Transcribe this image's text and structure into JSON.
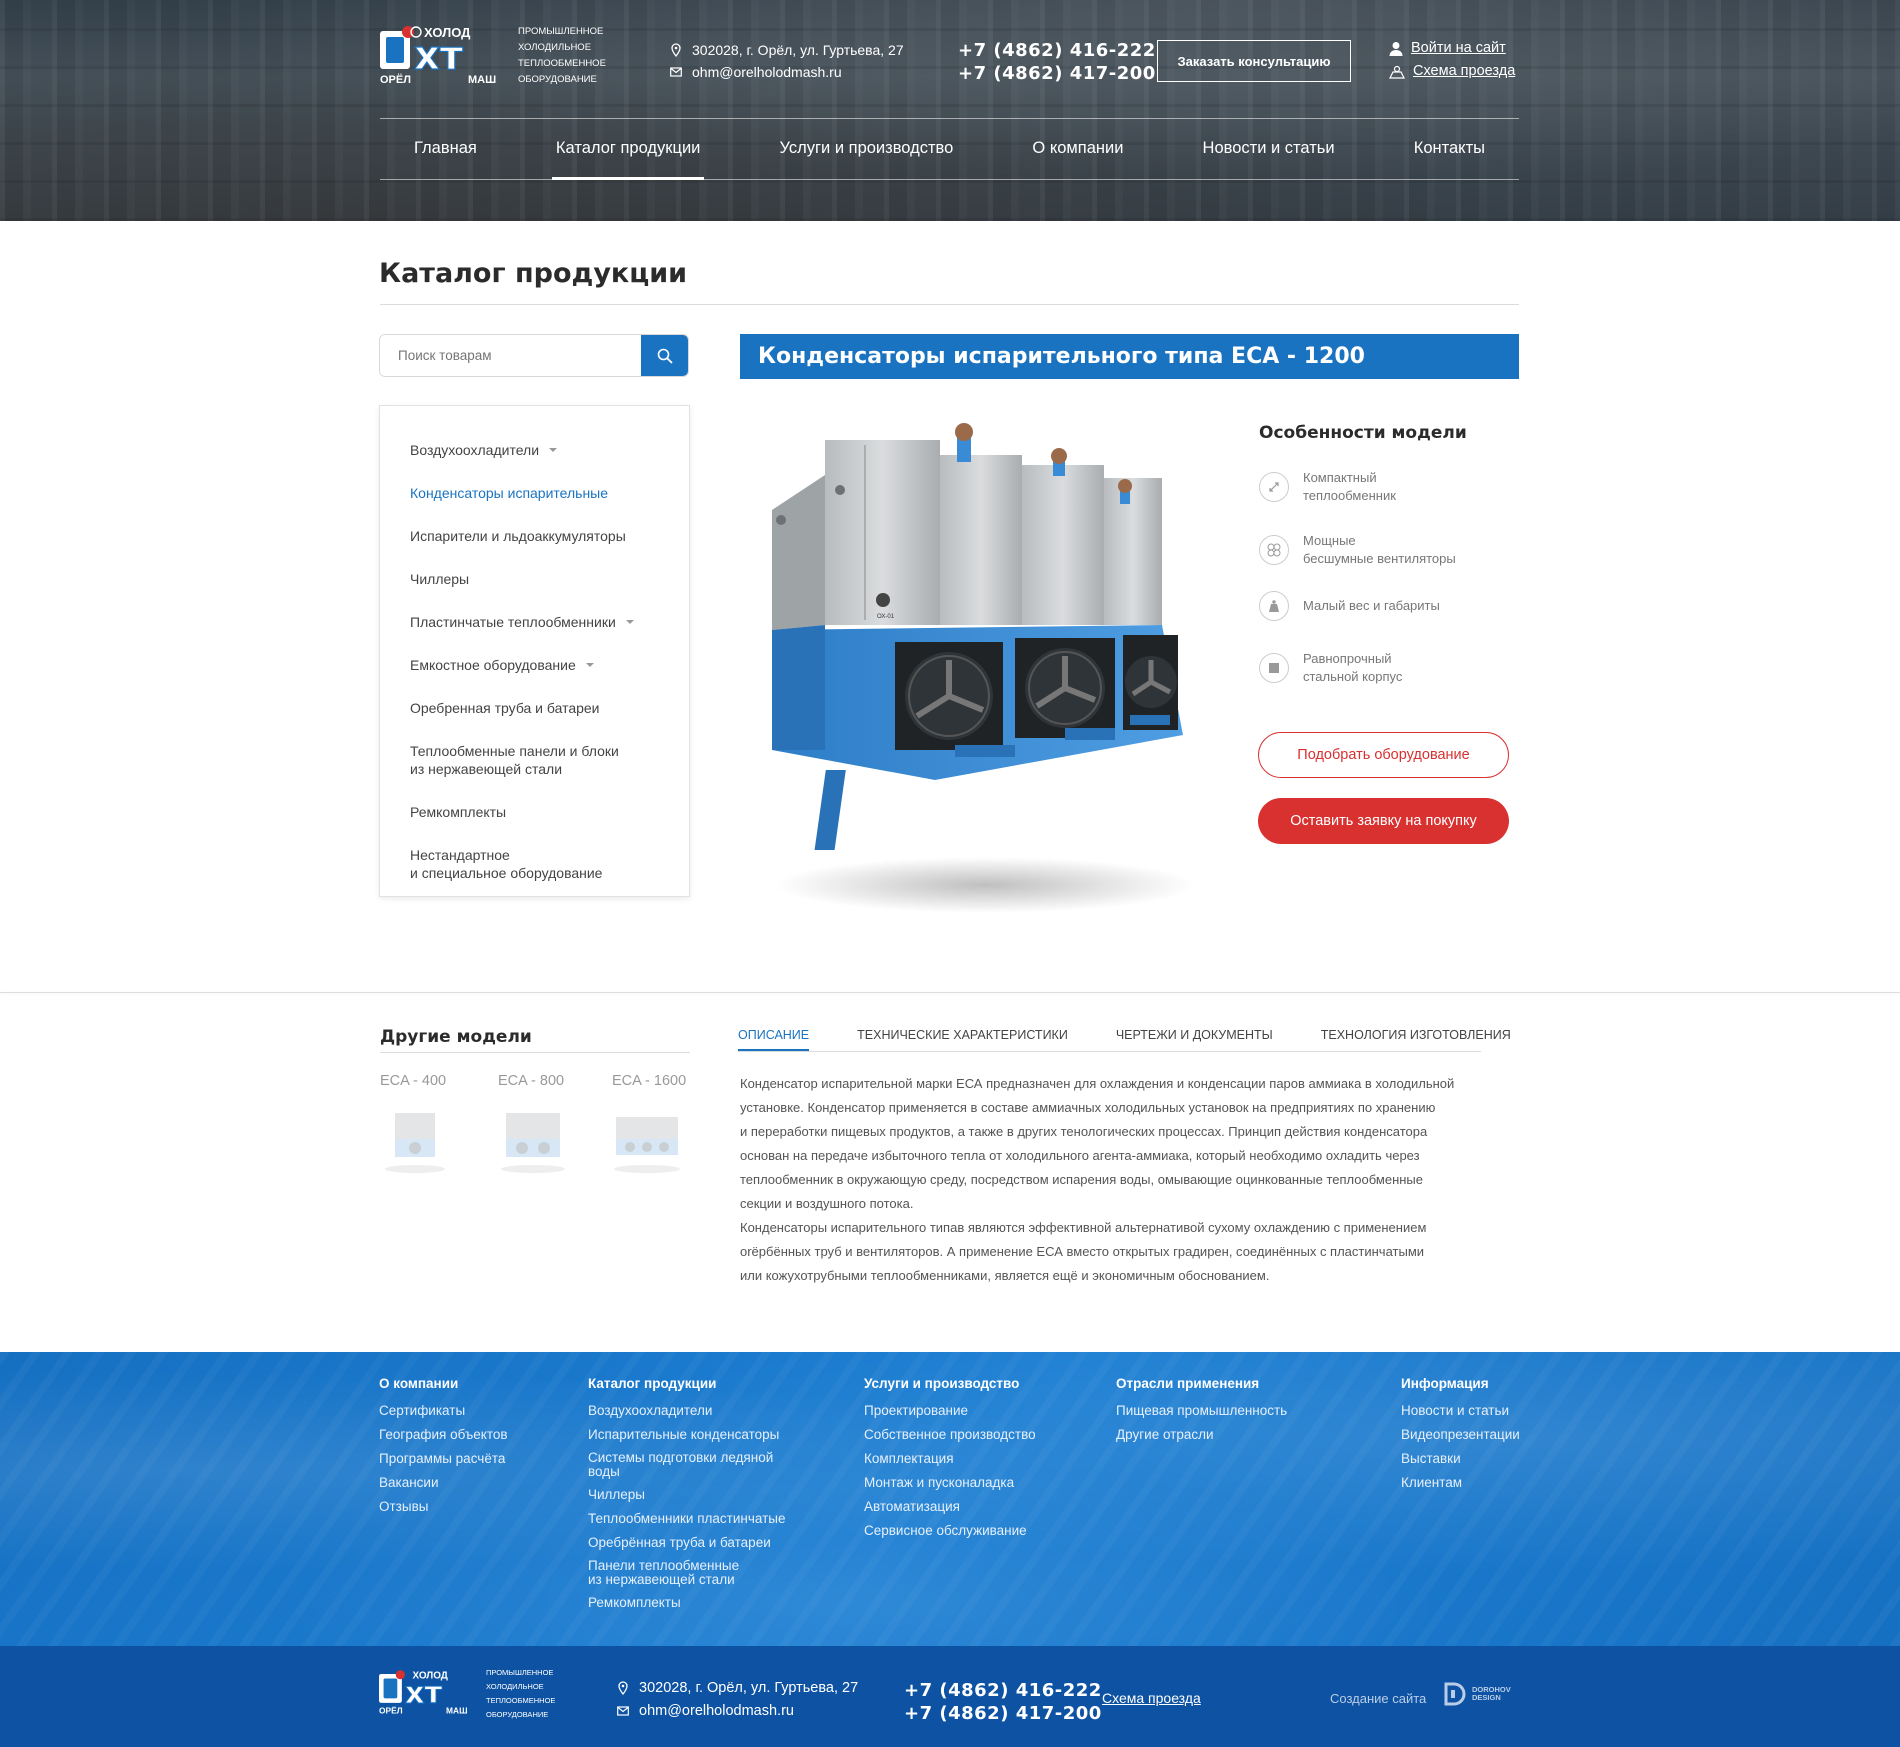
{
  "header": {
    "logo_text": {
      "top": "ХОЛОД",
      "left": "ОРЁЛ",
      "right": "МАШ"
    },
    "logo_subtitle": "ПРОМЫШЛЕННОЕ\nХОЛОДИЛЬНОЕ\nТЕПЛООБМЕННОЕ\nОБОРУДОВАНИЕ",
    "address": "302028, г. Орёл, ул. Гуртьева, 27",
    "email": "ohm@orelholodmash.ru",
    "phone1": "+7 (4862) 416-222",
    "phone2": "+7 (4862) 417-200",
    "consult_button": "Заказать консультацию",
    "login_link": "Войти на сайт",
    "map_link": "Схема проезда"
  },
  "nav": [
    {
      "label": "Главная",
      "active": false
    },
    {
      "label": "Каталог продукции",
      "active": true
    },
    {
      "label": "Услуги и производство",
      "active": false
    },
    {
      "label": "О компании",
      "active": false
    },
    {
      "label": "Новости и статьи",
      "active": false
    },
    {
      "label": "Контакты",
      "active": false
    }
  ],
  "page_title": "Каталог продукции",
  "search": {
    "placeholder": "Поиск товарам"
  },
  "categories": [
    {
      "label": "Воздухоохладители",
      "caret": true,
      "active": false
    },
    {
      "label": "Конденсаторы испарительные",
      "caret": false,
      "active": true
    },
    {
      "label": "Испарители и льдоаккумуляторы",
      "caret": false,
      "active": false
    },
    {
      "label": "Чиллеры",
      "caret": false,
      "active": false
    },
    {
      "label": "Пластинчатые теплообменники",
      "caret": true,
      "active": false
    },
    {
      "label": "Емкостное оборудование",
      "caret": true,
      "active": false
    },
    {
      "label": "Оребренная труба и батареи",
      "caret": false,
      "active": false
    },
    {
      "label": "Теплообменные панели и блоки\nиз нержавеющей стали",
      "caret": false,
      "active": false
    },
    {
      "label": "Ремкомплекты",
      "caret": false,
      "active": false
    },
    {
      "label": "Нестандартное\nи специальное оборудование",
      "caret": false,
      "active": false
    }
  ],
  "product": {
    "title": "Конденсаторы испарительного типа ECA - 1200",
    "image_label": "ОХ-01",
    "features_title": "Особенности модели",
    "features": [
      {
        "icon": "compact-icon",
        "text": "Компактный\nтеплообменник"
      },
      {
        "icon": "fan-icon",
        "text": "Мощные\nбесшумные вентиляторы"
      },
      {
        "icon": "weight-icon",
        "text": "Малый вес и габариты"
      },
      {
        "icon": "body-icon",
        "text": "Равнопрочный\nстальной корпус"
      }
    ],
    "select_button": "Подобрать оборудование",
    "order_button": "Оставить заявку на покупку"
  },
  "other_models": {
    "title": "Другие модели",
    "items": [
      "ECA - 400",
      "ECA - 800",
      "ECA - 1600"
    ]
  },
  "tabs": [
    {
      "label": "Описание",
      "active": true
    },
    {
      "label": "Технические характеристики",
      "active": false
    },
    {
      "label": "Чертежи и документы",
      "active": false
    },
    {
      "label": "Технология изготовления",
      "active": false
    }
  ],
  "description": [
    "Конденсатор испарительной марки ЕСА предназначен для охлаждения и конденсации паров аммиака в холодильной\nустановке. Конденсатор применяется в составе аммиачных холодильных установок на предприятиях по хранению\nи переработки пищевых продуктов, а также в других тенологических процессах. Принцип действия конденсатора\nоснован на передаче избыточного тепла от холодильного агента-аммиака, который необходимо охладить через\nтеплообменник в окружающую среду, посредством испарения воды, омывающие оцинкованные теплообменные\nсекции и воздушного потока.",
    "Конденсаторы испарительного типав являются эффективной альтернативой сухому охлаждению с применением\norёрбённых труб и вентиляторов. А применение ЕСА вместо открытых градирен, соединённых с пластинчатыми\nили кожухотрубными теплообменниками, является ещё и экономичным обоснованием."
  ],
  "footer": {
    "columns": [
      {
        "title": "О компании",
        "items": [
          "Сертификаты",
          "География объектов",
          "Программы расчёта",
          "Вакансии",
          "Отзывы"
        ]
      },
      {
        "title": "Каталог продукции",
        "items": [
          "Воздухоохладители",
          "Испарительные конденсаторы",
          "Системы подготовки ледяной\nводы",
          "Чиллеры",
          "Теплообменники пластинчатые",
          "Оребрённая труба и батареи",
          "Панели теплообменные\nиз нержавеющей стали",
          "Ремкомплекты"
        ]
      },
      {
        "title": "Услуги и производство",
        "items": [
          "Проектирование",
          "Собственное производство",
          "Комплектация",
          "Монтаж и пусконаладка",
          "Автоматизация",
          "Сервисное обслуживание"
        ]
      },
      {
        "title": "Отрасли применения",
        "items": [
          "Пищевая промышленность",
          "Другие отрасли"
        ]
      },
      {
        "title": "Информация",
        "items": [
          "Новости и статьи",
          "Видеопрезентации",
          "Выставки",
          "Клиентам"
        ]
      }
    ],
    "address": "302028, г. Орёл, ул. Гуртьева, 27",
    "email": "ohm@orelholodmash.ru",
    "phone1": "+7 (4862) 416-222",
    "phone2": "+7 (4862) 417-200",
    "map_link": "Схема проезда",
    "created_label": "Создание сайта",
    "studio": "DOROHOV\nDESIGN"
  },
  "colors": {
    "brand_blue": "#1a73c1",
    "accent_red": "#d93030",
    "footer_dark": "#0e53a3"
  }
}
